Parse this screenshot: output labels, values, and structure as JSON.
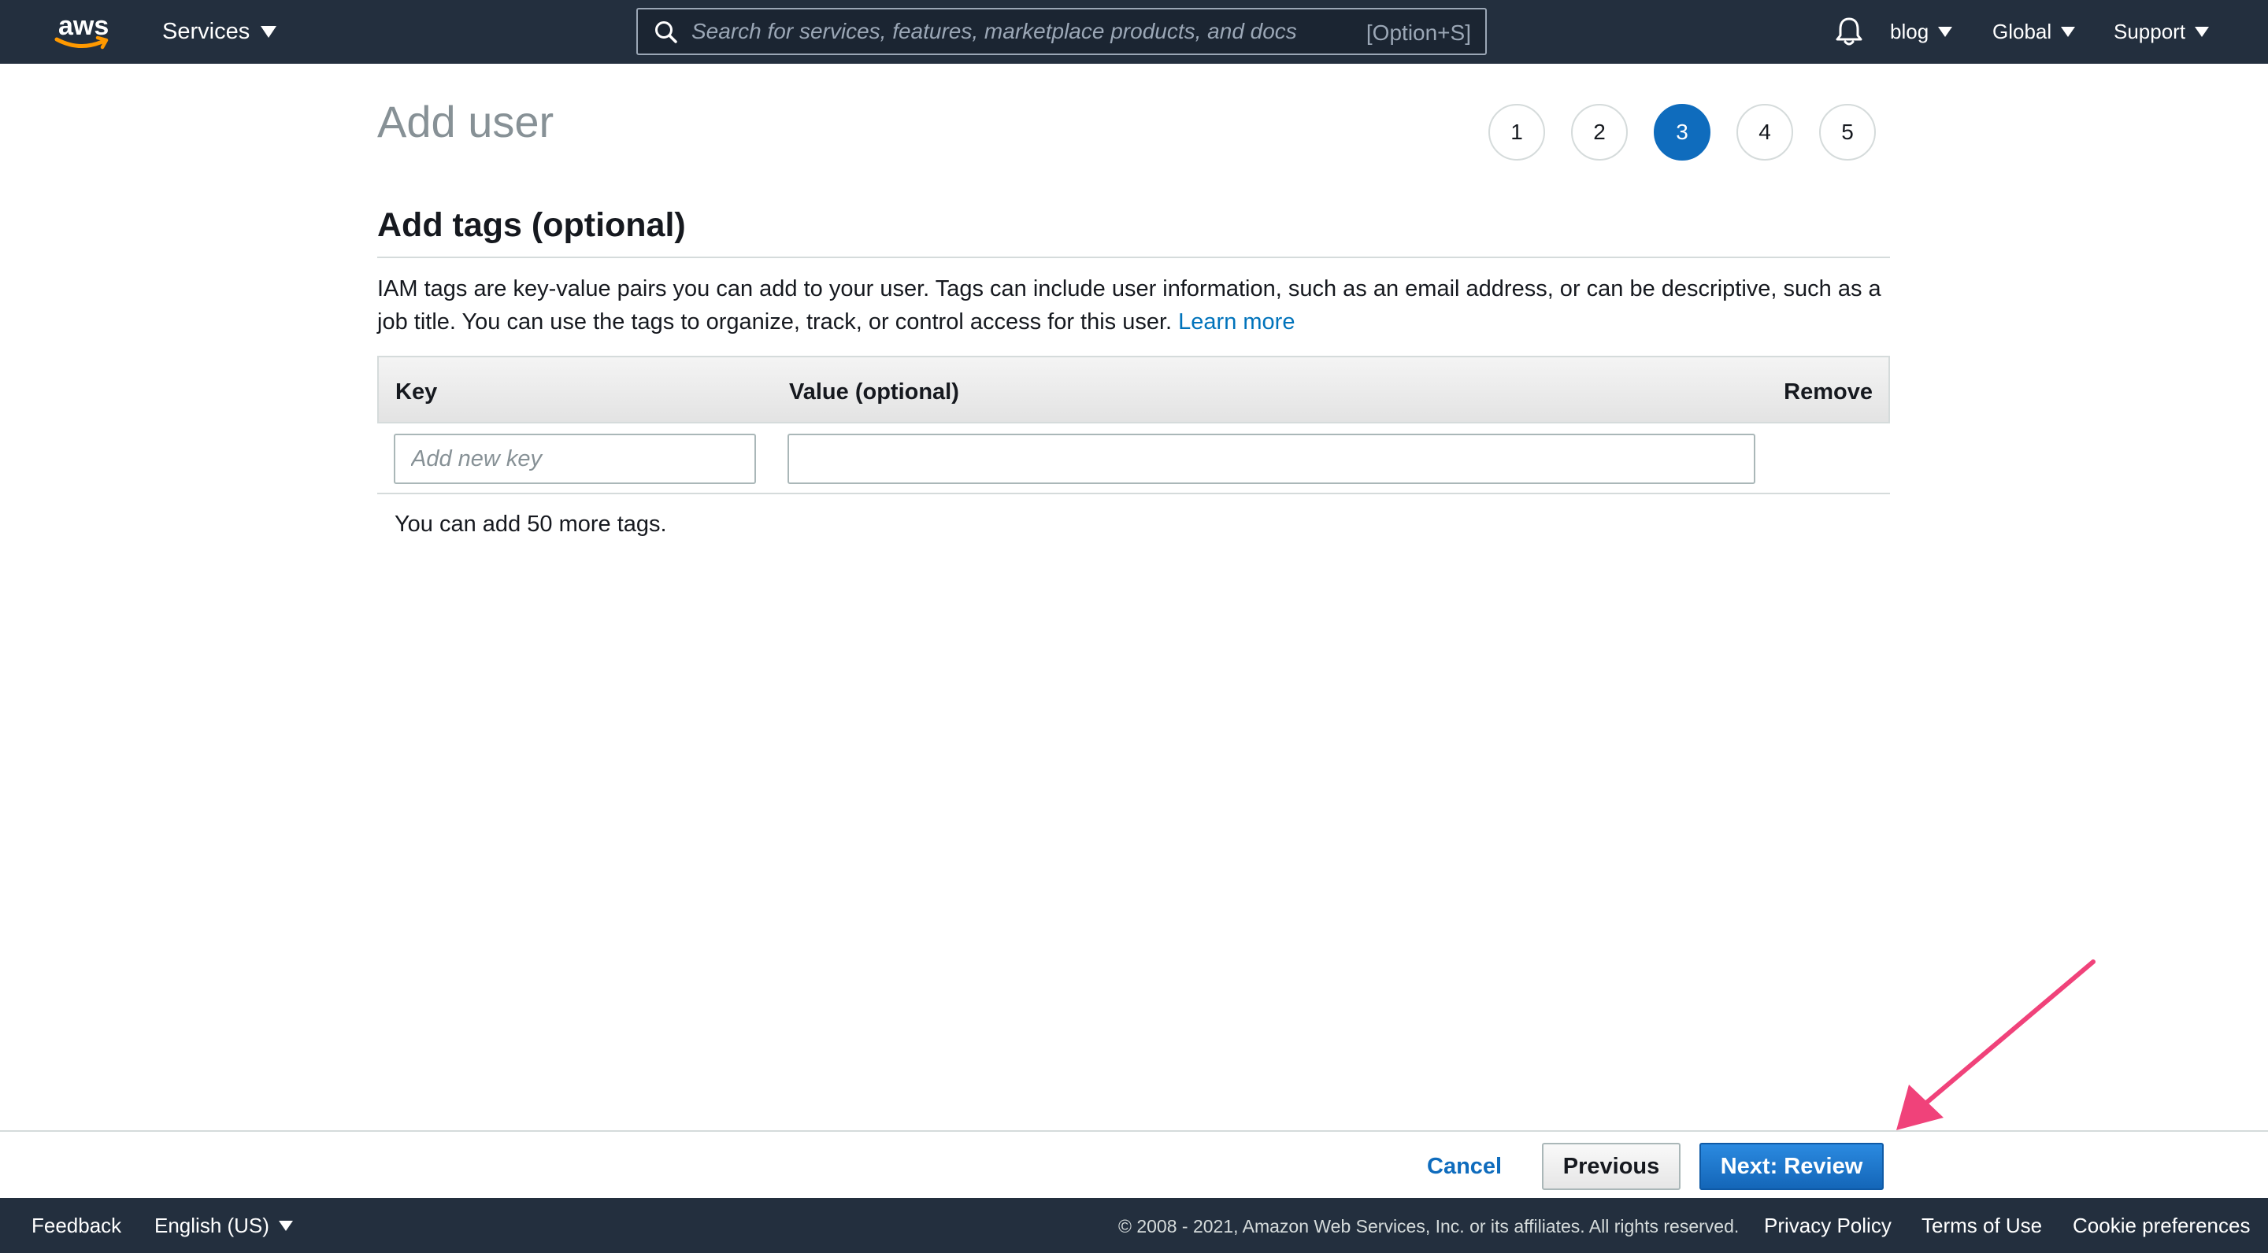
{
  "topnav": {
    "logo_text": "aws",
    "services_label": "Services",
    "search_placeholder": "Search for services, features, marketplace products, and docs",
    "search_shortcut": "[Option+S]",
    "account_label": "blog",
    "region_label": "Global",
    "support_label": "Support",
    "icons": [
      "search-icon",
      "bell-icon",
      "caret-down-icon"
    ]
  },
  "page": {
    "title": "Add user",
    "steps": [
      "1",
      "2",
      "3",
      "4",
      "5"
    ],
    "active_step": "3"
  },
  "section": {
    "title": "Add tags (optional)",
    "description": "IAM tags are key-value pairs you can add to your user. Tags can include user information, such as an email address, or can be descriptive, such as a job title. You can use the tags to organize, track, or control access for this user.",
    "learn_more": "Learn more"
  },
  "table": {
    "headers": {
      "key": "Key",
      "value": "Value (optional)",
      "remove": "Remove"
    },
    "key_placeholder": "Add new key",
    "key_value": "",
    "value_value": "",
    "tags_remaining": "You can add 50 more tags."
  },
  "actions": {
    "cancel": "Cancel",
    "previous": "Previous",
    "next": "Next: Review"
  },
  "footer": {
    "feedback": "Feedback",
    "language": "English (US)",
    "copyright": "© 2008 - 2021, Amazon Web Services, Inc. or its affiliates. All rights reserved.",
    "privacy": "Privacy Policy",
    "terms": "Terms of Use",
    "cookies": "Cookie preferences"
  },
  "colors": {
    "nav_bg": "#232f3e",
    "accent_blue": "#0f6cbd",
    "link_blue": "#0073bb",
    "annotation_arrow": "#f0427a",
    "aws_orange": "#ff9900"
  }
}
